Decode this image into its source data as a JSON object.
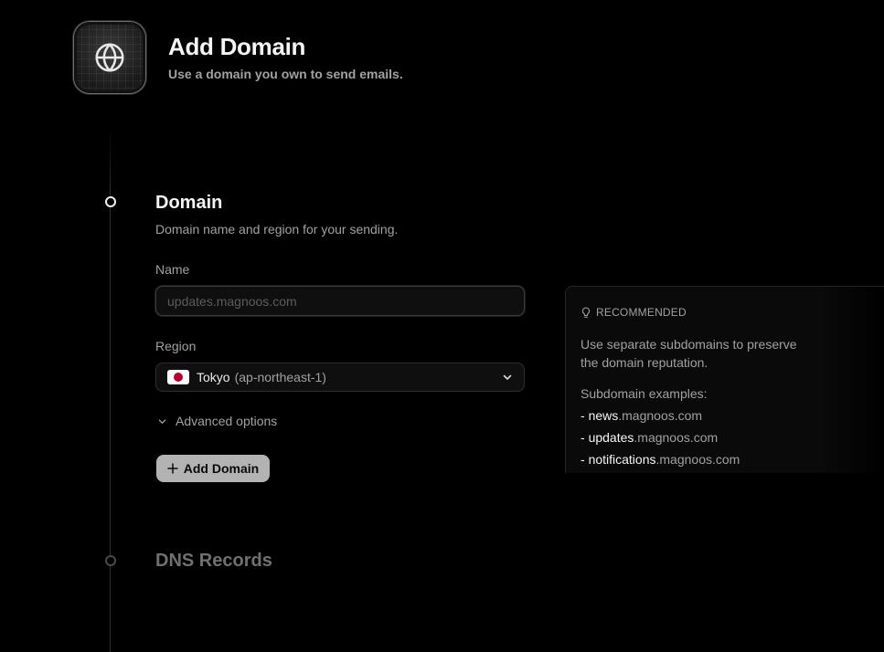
{
  "header": {
    "title": "Add Domain",
    "subtitle": "Use a domain you own to send emails.",
    "icon": "globe-icon"
  },
  "domain_section": {
    "title": "Domain",
    "subtitle": "Domain name and region for your sending.",
    "name_label": "Name",
    "name_placeholder": "updates.magnoos.com",
    "name_value": "",
    "region_label": "Region",
    "region_name": "Tokyo",
    "region_code": "(ap-northeast-1)",
    "region_flag": "japan-flag",
    "advanced_label": "Advanced options",
    "add_button_label": "Add Domain"
  },
  "dns_section": {
    "title": "DNS Records"
  },
  "recommended": {
    "heading": "RECOMMENDED",
    "icon": "lightbulb-icon",
    "text": "Use separate subdomains to preserve the domain reputation.",
    "examples_label": "Subdomain examples:",
    "examples": [
      {
        "dash": "- ",
        "sub": "news",
        "domain": ".magnoos.com"
      },
      {
        "dash": "- ",
        "sub": "updates",
        "domain": ".magnoos.com"
      },
      {
        "dash": "- ",
        "sub": "notifications",
        "domain": ".magnoos.com"
      }
    ]
  },
  "colors": {
    "background": "#000000",
    "text_primary": "#f5f5f5",
    "text_secondary": "#a1a1a1",
    "button_bg": "#b3b3b3"
  }
}
